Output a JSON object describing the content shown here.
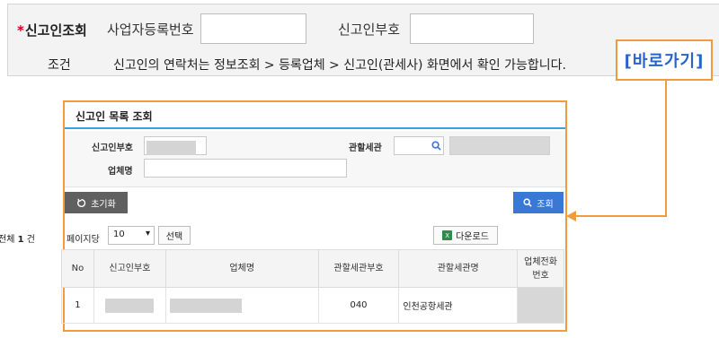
{
  "condition_panel": {
    "required_mark": "*",
    "title": "신고인조회",
    "business_no_label": "사업자등록번호",
    "declarant_no_label": "신고인부호",
    "subtitle": "조건",
    "info_text": "신고인의 연락처는 정보조회 > 등록업체 > 신고인(관세사) 화면에서 확인 가능합니다.",
    "goto_link": "[바로가기]"
  },
  "dialog": {
    "title": "신고인 목록 조회",
    "search": {
      "declarant_no_label": "신고인부호",
      "jurisdiction_label": "관할세관",
      "company_label": "업체명"
    },
    "buttons": {
      "reset": "초기화",
      "query": "조회"
    },
    "toolbar": {
      "total_prefix": "전체",
      "total_count": "1",
      "total_suffix": "건",
      "per_page_label": "페이지당",
      "per_page_value": "10",
      "select_button": "선택",
      "download_button": "다운로드"
    },
    "table": {
      "headers": [
        "No",
        "신고인부호",
        "업체명",
        "관할세관부호",
        "관할세관명",
        "업체전화\n번호"
      ],
      "rows": [
        {
          "no": "1",
          "customs_code": "040",
          "customs_name": "인천공항세관"
        }
      ]
    }
  },
  "colors": {
    "highlight_orange": "#f29a3c",
    "link_blue": "#2a63c7",
    "header_line_blue": "#3aa0d9",
    "query_button_blue": "#3a78d6",
    "reset_button_gray": "#606060",
    "required_red": "#d0021b"
  }
}
